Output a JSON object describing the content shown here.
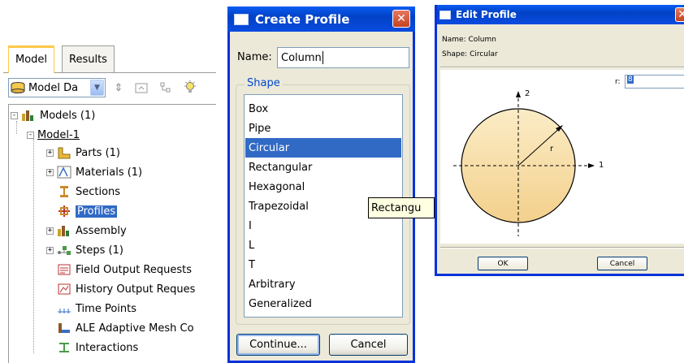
{
  "model_tree": {
    "tabs": [
      {
        "label": "Model",
        "active": true
      },
      {
        "label": "Results",
        "active": false
      }
    ],
    "toolbar": {
      "combo_value": "Model Da",
      "icons": [
        "model-database-icon",
        "up-down-arrows-icon",
        "expand-tree-icon",
        "filter-tree-icon",
        "lightbulb-icon"
      ]
    },
    "nodes": [
      {
        "label": "Models (1)",
        "expander": "-",
        "icon": "models-icon"
      },
      {
        "label": "Model-1",
        "expander": "-",
        "icon": ""
      },
      {
        "label": "Parts (1)",
        "expander": "+",
        "icon": "parts-icon"
      },
      {
        "label": "Materials (1)",
        "expander": "+",
        "icon": "materials-icon"
      },
      {
        "label": "Sections",
        "expander": "",
        "icon": "sections-icon"
      },
      {
        "label": "Profiles",
        "expander": "",
        "icon": "profiles-icon",
        "selected": true
      },
      {
        "label": "Assembly",
        "expander": "+",
        "icon": "assembly-icon"
      },
      {
        "label": "Steps (1)",
        "expander": "+",
        "icon": "steps-icon"
      },
      {
        "label": "Field Output Requests",
        "expander": "",
        "icon": "field-output-icon"
      },
      {
        "label": "History Output Reques",
        "expander": "",
        "icon": "history-output-icon"
      },
      {
        "label": "Time Points",
        "expander": "",
        "icon": "time-points-icon"
      },
      {
        "label": "ALE Adaptive Mesh Co",
        "expander": "",
        "icon": "ale-mesh-icon"
      },
      {
        "label": "Interactions",
        "expander": "",
        "icon": "interactions-icon"
      }
    ]
  },
  "create_profile": {
    "title": "Create Profile",
    "name_label": "Name:",
    "name_value": "Column",
    "shape_label": "Shape",
    "shapes": [
      "Box",
      "Pipe",
      "Circular",
      "Rectangular",
      "Hexagonal",
      "Trapezoidal",
      "I",
      "L",
      "T",
      "Arbitrary",
      "Generalized"
    ],
    "selected_shape": "Circular",
    "tooltip": "Rectangu",
    "continue_label": "Continue...",
    "cancel_label": "Cancel"
  },
  "edit_profile": {
    "title": "Edit Profile",
    "name_line": "Name:  Column",
    "shape_line": "Shape:  Circular",
    "r_label": "r:",
    "r_value": "8",
    "axis_1": "1",
    "axis_2": "2",
    "radius_label": "r",
    "ok_label": "OK",
    "cancel_label": "Cancel"
  },
  "colors": {
    "title_blue": "#0a5cf3",
    "selection": "#316ac5",
    "dialog_bg": "#ece9d8",
    "tab_accent": "#ffc846",
    "circle_fill_top": "#fbecc6",
    "circle_fill_bottom": "#f3d08c"
  }
}
